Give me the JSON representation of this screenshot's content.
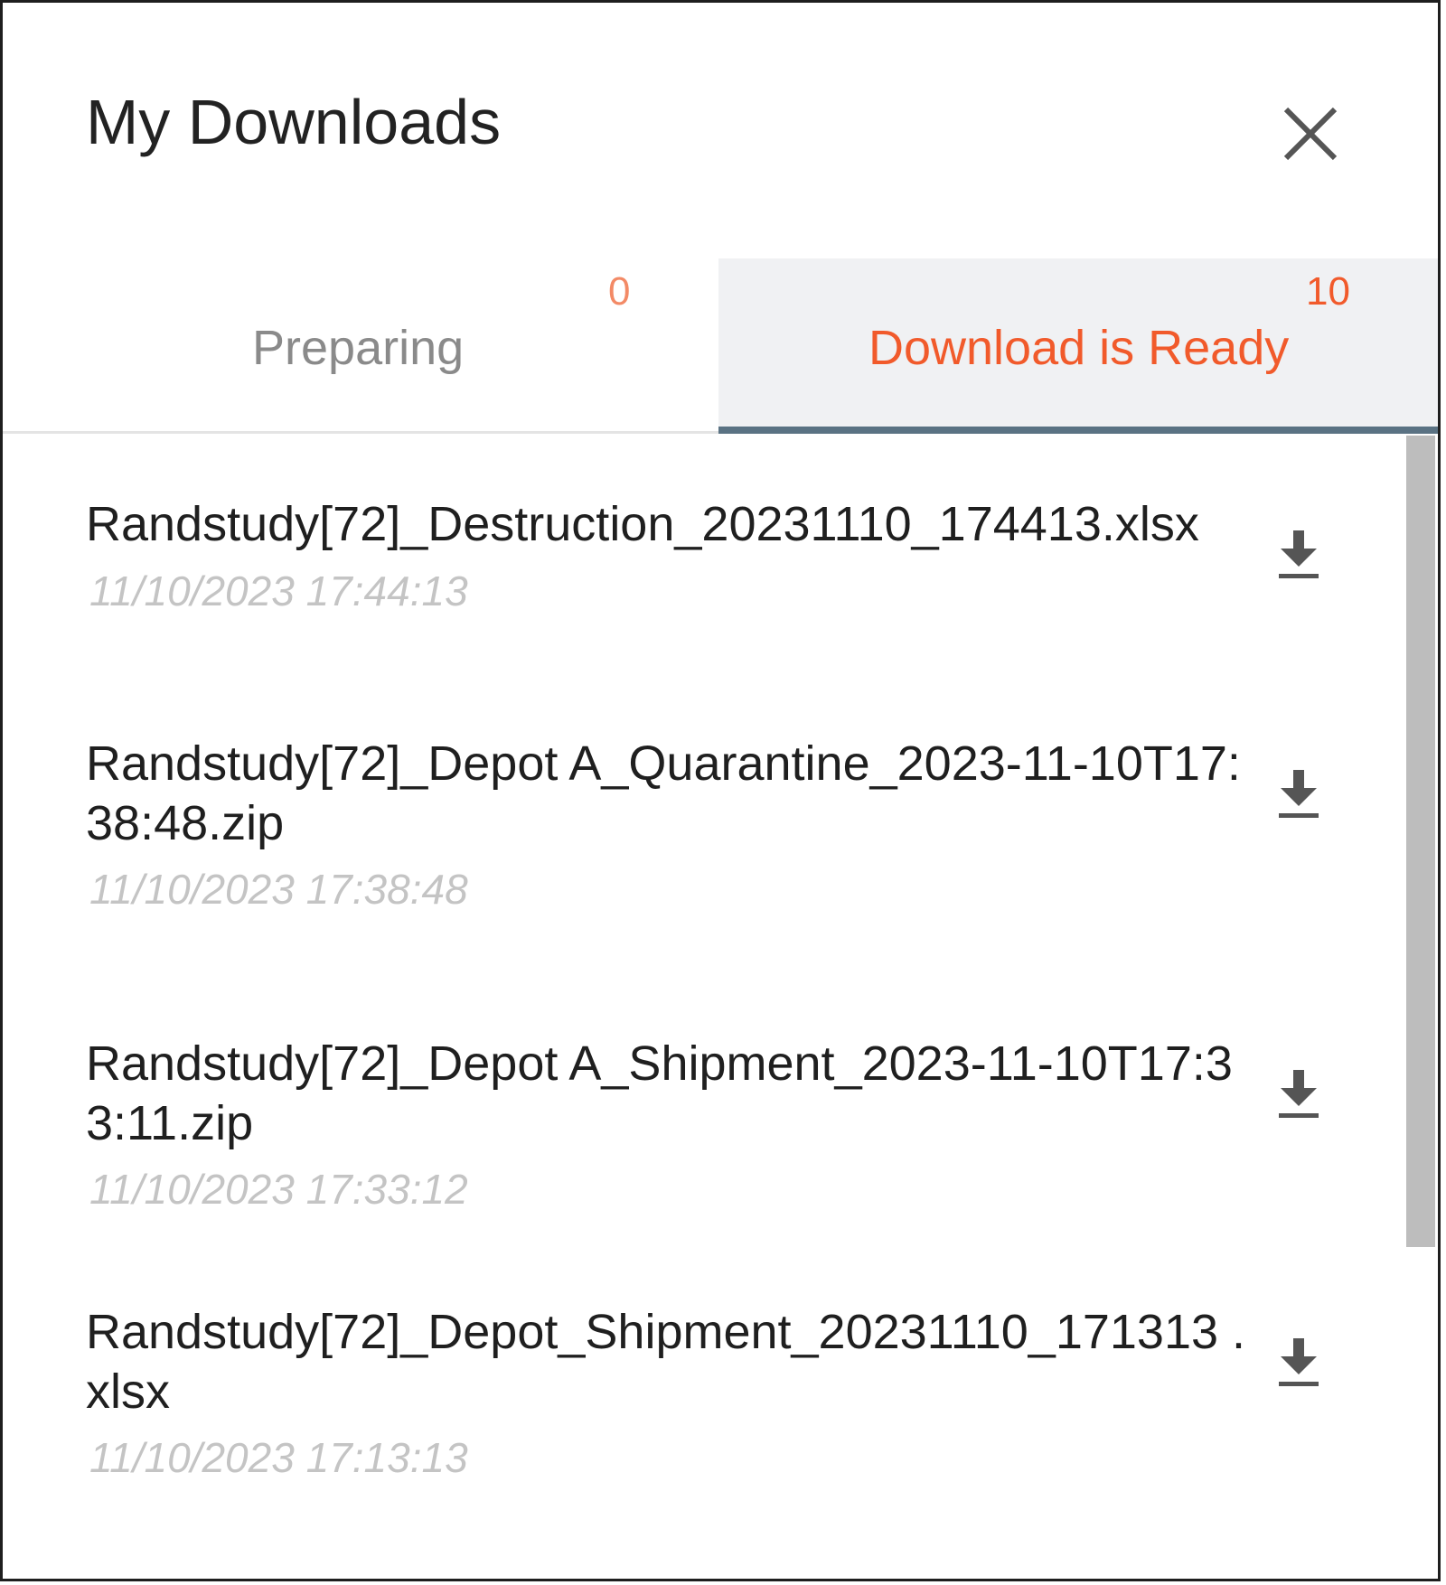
{
  "header": {
    "title": "My Downloads",
    "close_icon": "close-icon"
  },
  "tabs": [
    {
      "label": "Preparing",
      "count": "0",
      "active": false
    },
    {
      "label": "Download is Ready",
      "count": "10",
      "active": true
    }
  ],
  "items": [
    {
      "name": "Randstudy[72]_Destruction_20231110_174413.xlsx",
      "date": "11/10/2023 17:44:13",
      "icon": "download-icon"
    },
    {
      "name": "Randstudy[72]_Depot A_Quarantine_2023-11-10T17:38:48.zip",
      "date": "11/10/2023 17:38:48",
      "icon": "download-icon"
    },
    {
      "name": "Randstudy[72]_Depot A_Shipment_2023-11-10T17:33:11.zip",
      "date": "11/10/2023 17:33:12",
      "icon": "download-icon"
    },
    {
      "name": "Randstudy[72]_Depot_Shipment_20231110_171313 .xlsx",
      "date": "11/10/2023 17:13:13",
      "icon": "download-icon"
    }
  ],
  "colors": {
    "accent": "#f15a2b",
    "tab_underline": "#5a7283",
    "active_tab_bg": "#f0f1f3",
    "inactive_text": "#8a8a8a",
    "date_text": "#c4c4c4"
  }
}
